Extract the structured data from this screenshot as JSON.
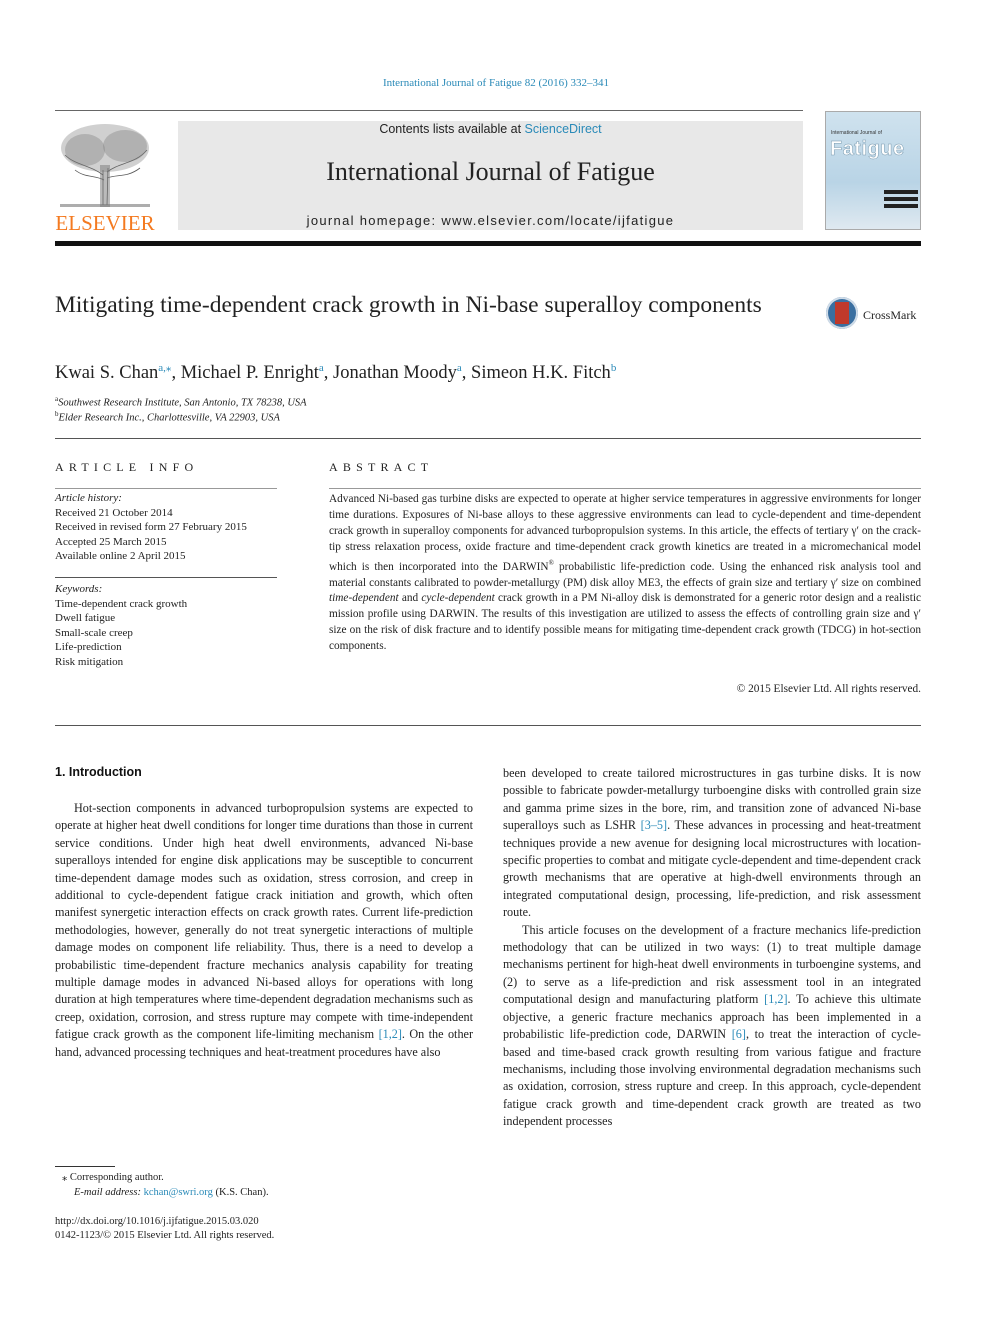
{
  "journal_ref": "International Journal of Fatigue 82 (2016) 332–341",
  "publisher_logo_text": "ELSEVIER",
  "banner": {
    "contents_prefix": "Contents lists available at ",
    "contents_link": "ScienceDirect",
    "journal_title": "International Journal of Fatigue",
    "homepage_label": "journal homepage: ",
    "homepage_url": "www.elsevier.com/locate/ijfatigue"
  },
  "cover": {
    "small_title": "International Journal of",
    "big_title": "Fatigue"
  },
  "crossmark_label": "CrossMark",
  "title": "Mitigating time-dependent crack growth in Ni-base superalloy components",
  "authors": [
    {
      "name": "Kwai S. Chan",
      "sup": "a,⁎",
      "sep": ", "
    },
    {
      "name": "Michael P. Enright",
      "sup": "a",
      "sep": ", "
    },
    {
      "name": "Jonathan Moody",
      "sup": "a",
      "sep": ", "
    },
    {
      "name": "Simeon H.K. Fitch",
      "sup": "b",
      "sep": ""
    }
  ],
  "affiliations": [
    {
      "mark": "a",
      "text": "Southwest Research Institute, San Antonio, TX 78238, USA"
    },
    {
      "mark": "b",
      "text": "Elder Research Inc., Charlottesville, VA 22903, USA"
    }
  ],
  "article_info": {
    "heading": "ARTICLE INFO",
    "history_label": "Article history:",
    "history": [
      "Received 21 October 2014",
      "Received in revised form 27 February 2015",
      "Accepted 25 March 2015",
      "Available online 2 April 2015"
    ],
    "keywords_label": "Keywords:",
    "keywords": [
      "Time-dependent crack growth",
      "Dwell fatigue",
      "Small-scale creep",
      "Life-prediction",
      "Risk mitigation"
    ]
  },
  "abstract": {
    "heading": "ABSTRACT",
    "p1": "Advanced Ni-based gas turbine disks are expected to operate at higher service temperatures in aggressive environments for longer time durations. Exposures of Ni-base alloys to these aggressive environments can lead to cycle-dependent and time-dependent crack growth in superalloy components for advanced turbopropulsion systems. In this article, the effects of tertiary γ′ on the crack-tip stress relaxation process, oxide fracture and time-dependent crack growth kinetics are treated in a micromechanical model which is then incorporated into the DARWIN",
    "reg": "®",
    "p2": " probabilistic life-prediction code. Using the enhanced risk analysis tool and material constants calibrated to powder-metallurgy (PM) disk alloy ME3, the effects of grain size and tertiary γ′ size on combined ",
    "em1": "time-dependent",
    "p3": " and ",
    "em2": "cycle-dependent",
    "p4": " crack growth in a PM Ni-alloy disk is demonstrated for a generic rotor design and a realistic mission profile using DARWIN. The results of this investigation are utilized to assess the effects of controlling grain size and γ′ size on the risk of disk fracture and to identify possible means for mitigating time-dependent crack growth (TDCG) in hot-section components.",
    "copyright": "© 2015 Elsevier Ltd. All rights reserved."
  },
  "intro": {
    "heading": "1. Introduction",
    "left_p1a": "Hot-section components in advanced turbopropulsion systems are expected to operate at higher heat dwell conditions for longer time durations than those in current service conditions. Under high heat dwell environments, advanced Ni-base superalloys intended for engine disk applications may be susceptible to concurrent time-dependent damage modes such as oxidation, stress corrosion, and creep in additional to cycle-dependent fatigue crack initiation and growth, which often manifest synergetic interaction effects on crack growth rates. Current life-prediction methodologies, however, generally do not treat synergetic interactions of multiple damage modes on component life reliability. Thus, there is a need to develop a probabilistic time-dependent fracture mechanics analysis capability for treating multiple damage modes in advanced Ni-based alloys for operations with long duration at high temperatures where time-dependent degradation mechanisms such as creep, oxidation, corrosion, and stress rupture may compete with time-independent fatigue crack growth as the component life-limiting mechanism ",
    "left_ref1": "[1,2]",
    "left_p1b": ". On the other hand, advanced processing techniques and heat-treatment procedures have also",
    "right_p1a": "been developed to create tailored microstructures in gas turbine disks. It is now possible to fabricate powder-metallurgy turboengine disks with controlled grain size and gamma prime sizes in the bore, rim, and transition zone of advanced Ni-base superalloys such as LSHR ",
    "right_ref1": "[3–5]",
    "right_p1b": ". These advances in processing and heat-treatment techniques provide a new avenue for designing local microstructures with location-specific properties to combat and mitigate cycle-dependent and time-dependent crack growth mechanisms that are operative at high-dwell environments through an integrated computational design, processing, life-prediction, and risk assessment route.",
    "right_p2a": "This article focuses on the development of a fracture mechanics life-prediction methodology that can be utilized in two ways: (1) to treat multiple damage mechanisms pertinent for high-heat dwell environments in turboengine systems, and (2) to serve as a life-prediction and risk assessment tool in an integrated computational design and manufacturing platform ",
    "right_ref2": "[1,2]",
    "right_p2b": ". To achieve this ultimate objective, a generic fracture mechanics approach has been implemented in a probabilistic life-prediction code, DARWIN ",
    "right_ref3": "[6]",
    "right_p2c": ", to treat the interaction of cycle-based and time-based crack growth resulting from various fatigue and fracture mechanisms, including those involving environmental degradation mechanisms such as oxidation, corrosion, stress rupture and creep. In this approach, cycle-dependent fatigue crack growth and time-dependent crack growth are treated as two independent processes"
  },
  "footnote": {
    "star": "⁎",
    "corresponding": "Corresponding author.",
    "email_label": "E-mail address: ",
    "email": "kchan@swri.org",
    "email_suffix": " (K.S. Chan).",
    "doi": "http://dx.doi.org/10.1016/j.ijfatigue.2015.03.020",
    "issn_line": "0142-1123/© 2015 Elsevier Ltd. All rights reserved."
  }
}
